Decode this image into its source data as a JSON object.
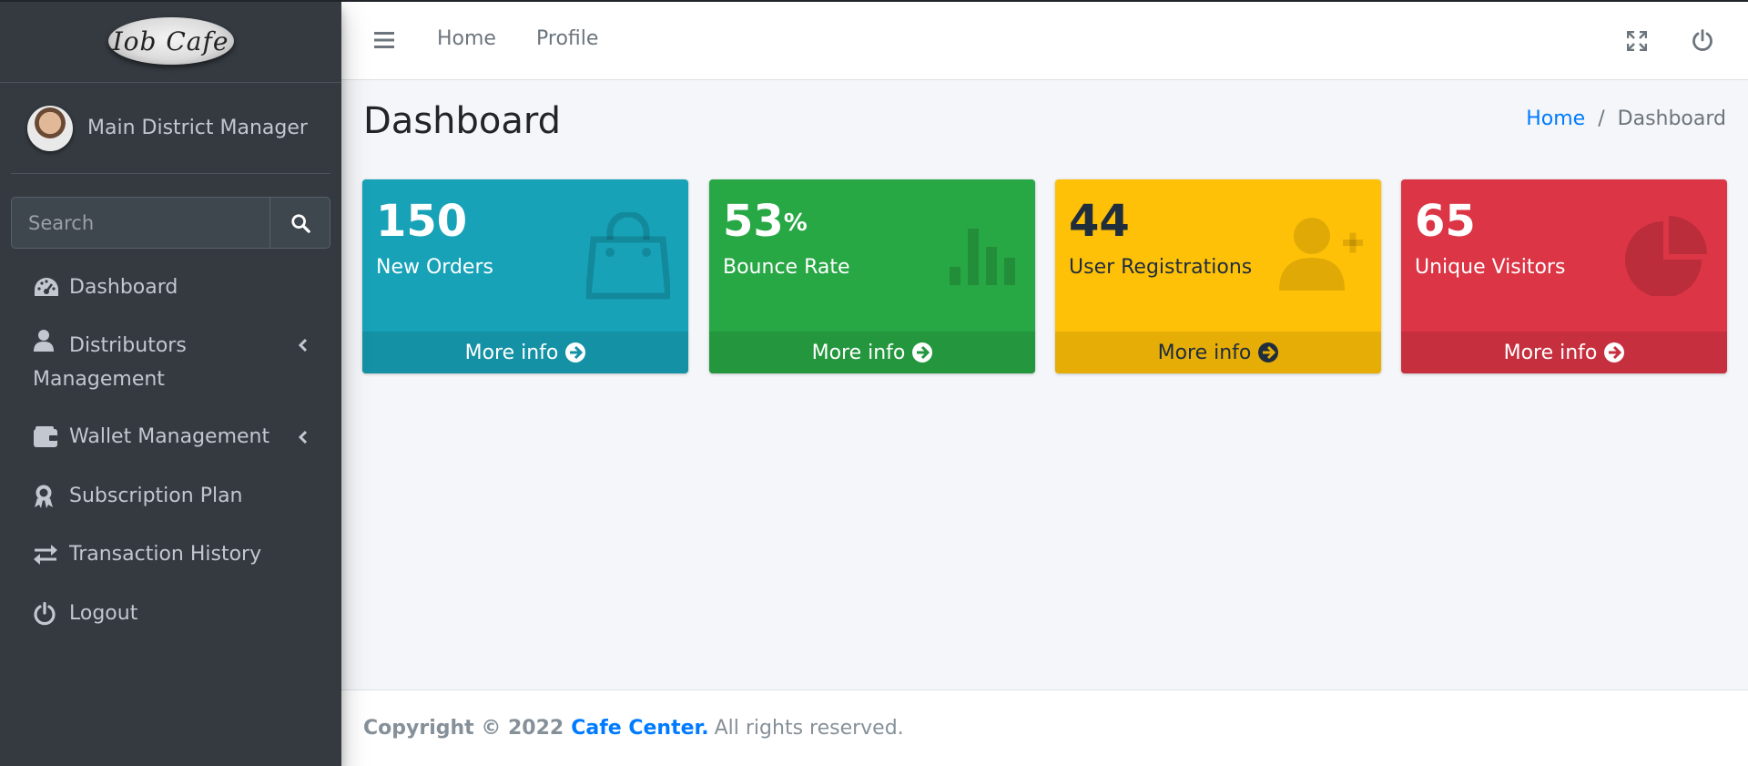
{
  "brand": {
    "logo_text": "Iob Cafe"
  },
  "user": {
    "name": "Main District Manager"
  },
  "search": {
    "placeholder": "Search"
  },
  "sidebar": {
    "items": [
      {
        "label": "Dashboard",
        "icon": "tachometer-icon"
      },
      {
        "label": "Distributors Management",
        "icon": "user-icon",
        "has_submenu": true
      },
      {
        "label": "Wallet Management",
        "icon": "wallet-icon",
        "has_submenu": true
      },
      {
        "label": "Subscription Plan",
        "icon": "award-icon"
      },
      {
        "label": "Transaction History",
        "icon": "exchange-icon"
      },
      {
        "label": "Logout",
        "icon": "power-icon"
      }
    ]
  },
  "navbar": {
    "links": [
      "Home",
      "Profile"
    ],
    "icons": [
      "hamburger-icon",
      "fullscreen-icon",
      "power-icon"
    ]
  },
  "page": {
    "title": "Dashboard"
  },
  "breadcrumb": {
    "home": "Home",
    "separator": "/",
    "current": "Dashboard"
  },
  "boxes": [
    {
      "value": "150",
      "suffix": "",
      "label": "New Orders",
      "footer": "More info",
      "color": "#17a2b8",
      "icon": "shopping-bag-icon"
    },
    {
      "value": "53",
      "suffix": "%",
      "label": "Bounce Rate",
      "footer": "More info",
      "color": "#28a745",
      "icon": "bar-chart-icon"
    },
    {
      "value": "44",
      "suffix": "",
      "label": "User Registrations",
      "footer": "More info",
      "color": "#ffc107",
      "icon": "user-plus-icon"
    },
    {
      "value": "65",
      "suffix": "",
      "label": "Unique Visitors",
      "footer": "More info",
      "color": "#dc3545",
      "icon": "pie-chart-icon"
    }
  ],
  "footer": {
    "copyright": "Copyright © 2022",
    "company": "Cafe Center.",
    "rights": "All rights reserved."
  }
}
